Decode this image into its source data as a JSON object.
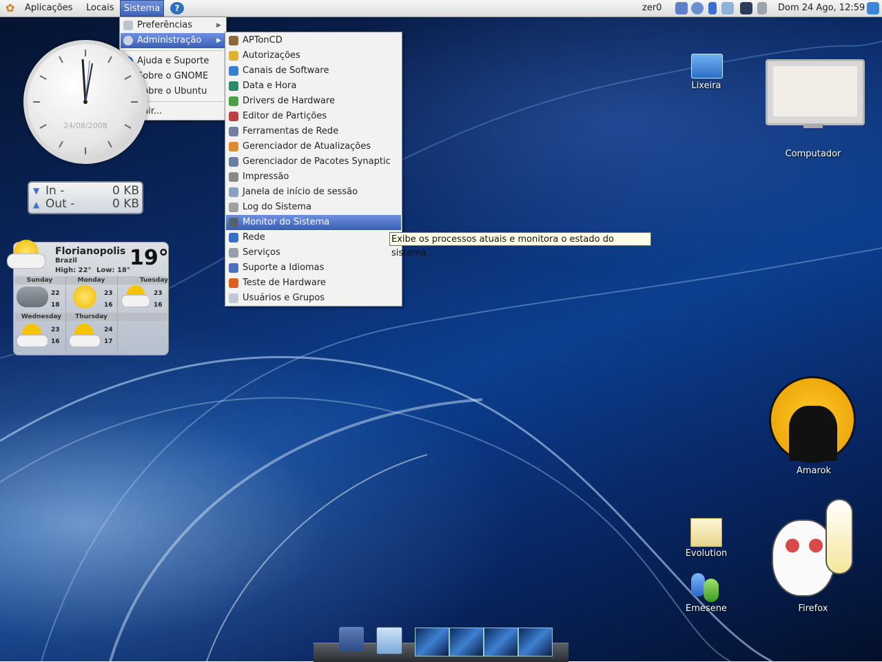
{
  "top_panel": {
    "menu_applications": "Aplicações",
    "menu_places": "Locais",
    "menu_system": "Sistema",
    "username": "zer0",
    "clock": "Dom 24 Ago, 12:59"
  },
  "system_menu": {
    "items": [
      {
        "label": "Preferências",
        "icon": "preferences-icon"
      },
      {
        "label": "Administração",
        "icon": "gear-icon"
      },
      {
        "label": "Ajuda e Suporte",
        "icon": "help-icon"
      },
      {
        "label": "Sobre o GNOME",
        "icon": "gnome-foot-icon"
      },
      {
        "label": "Sobre o Ubuntu",
        "icon": "ubuntu-icon"
      },
      {
        "label": "Sair...",
        "icon": "logout-icon"
      }
    ]
  },
  "admin_menu": {
    "items": [
      {
        "label": "APTonCD"
      },
      {
        "label": "Autorizações"
      },
      {
        "label": "Canais de Software"
      },
      {
        "label": "Data e Hora"
      },
      {
        "label": "Drivers de Hardware"
      },
      {
        "label": "Editor de Partições"
      },
      {
        "label": "Ferramentas de Rede"
      },
      {
        "label": "Gerenciador de Atualizações"
      },
      {
        "label": "Gerenciador de Pacotes Synaptic"
      },
      {
        "label": "Impressão"
      },
      {
        "label": "Janela de início de sessão"
      },
      {
        "label": "Log do Sistema"
      },
      {
        "label": "Monitor do Sistema"
      },
      {
        "label": "Rede"
      },
      {
        "label": "Serviços"
      },
      {
        "label": "Suporte a Idiomas"
      },
      {
        "label": "Teste de Hardware"
      },
      {
        "label": "Usuários e Grupos"
      }
    ],
    "highlighted": "Monitor do Sistema",
    "tooltip": "Exibe os processos atuais e monitora o estado do sistema"
  },
  "desktop_icons": {
    "trash": "Lixeira",
    "computer": "Computador",
    "amarok": "Amarok",
    "evolution": "Evolution",
    "emesene": "Emesene",
    "firefox": "Firefox"
  },
  "clock_widget": {
    "date": "24/08/2008"
  },
  "net_widget": {
    "in_label": "In -",
    "in_value": "0 KB",
    "out_label": "Out -",
    "out_value": "0 KB"
  },
  "weather_widget": {
    "city": "Florianopolis",
    "country": "Brazil",
    "high": "High: 22°",
    "low": "Low: 18°",
    "temp": "19°",
    "days": [
      {
        "name": "Sunday",
        "high": "22",
        "low": "18",
        "icon": "storm-icon"
      },
      {
        "name": "Monday",
        "high": "23",
        "low": "16",
        "icon": "sun-icon"
      },
      {
        "name": "Tuesday",
        "high": "23",
        "low": "16",
        "icon": "partly-cloudy-icon"
      },
      {
        "name": "Wednesday",
        "high": "23",
        "low": "16",
        "icon": "partly-cloudy-icon"
      },
      {
        "name": "Thursday",
        "high": "24",
        "low": "17",
        "icon": "partly-cloudy-icon"
      }
    ]
  },
  "colors": {
    "highlight": "#3a5fb8",
    "panel": "#e4e4e4"
  }
}
